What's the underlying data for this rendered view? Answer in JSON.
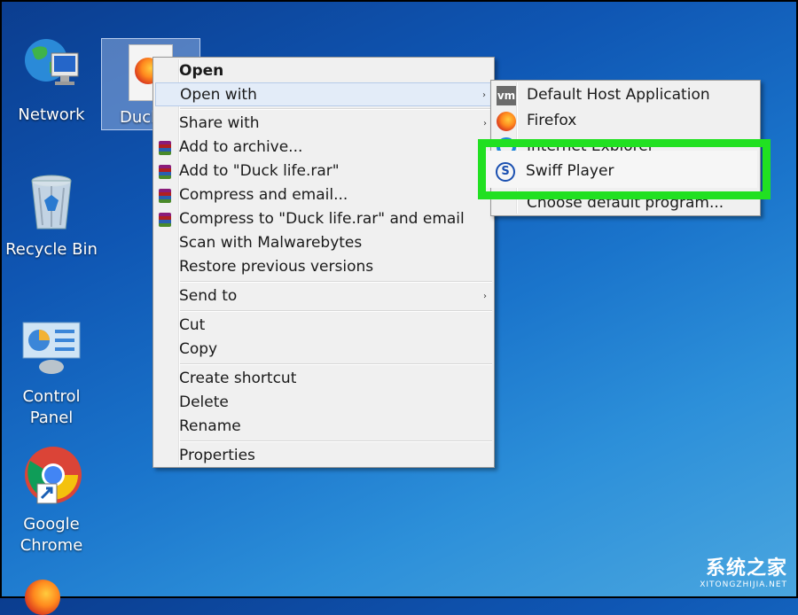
{
  "desktop": {
    "icons": [
      {
        "label": "Network",
        "icon": "network-globe-icon"
      },
      {
        "label": "Recycle Bin",
        "icon": "recycle-bin-icon"
      },
      {
        "label": "Control Panel",
        "icon": "control-panel-icon"
      },
      {
        "label_line1": "Google",
        "label_line2": "Chrome",
        "icon": "chrome-icon"
      }
    ],
    "selected_file": {
      "label": "Duck",
      "icon": "firefox-file-icon"
    }
  },
  "context_menu": {
    "items": [
      {
        "label": "Open",
        "bold": true
      },
      {
        "label": "Open with",
        "submenu": true,
        "highlighted": true
      },
      {
        "label": "Share with",
        "submenu": true
      },
      {
        "label": "Add to archive...",
        "icon": "winrar-icon"
      },
      {
        "label": "Add to \"Duck life.rar\"",
        "icon": "winrar-icon"
      },
      {
        "label": "Compress and email...",
        "icon": "winrar-icon"
      },
      {
        "label": "Compress to \"Duck life.rar\" and email",
        "icon": "winrar-icon"
      },
      {
        "label": "Scan with Malwarebytes"
      },
      {
        "label": "Restore previous versions"
      },
      {
        "label": "Send to",
        "submenu": true
      },
      {
        "label": "Cut"
      },
      {
        "label": "Copy"
      },
      {
        "label": "Create shortcut"
      },
      {
        "label": "Delete"
      },
      {
        "label": "Rename"
      },
      {
        "label": "Properties"
      }
    ],
    "arrow": "›"
  },
  "open_with_submenu": {
    "items": [
      {
        "label": "Default Host Application",
        "icon": "vm-icon",
        "icon_text": "vm"
      },
      {
        "label": "Firefox",
        "icon": "firefox-icon"
      },
      {
        "label": "Internet Explorer",
        "icon": "internet-explorer-icon"
      },
      {
        "label": "Swiff Player",
        "icon": "swiff-player-icon",
        "icon_text": "S"
      },
      {
        "label": "Choose default program..."
      }
    ]
  },
  "watermark": {
    "text": "系统之家",
    "subtext": "XITONGZHIJIA.NET"
  },
  "colors": {
    "highlight_box": "#21e021",
    "menu_bg": "#f0f0f0",
    "desktop_blue": "#0f56b3"
  }
}
